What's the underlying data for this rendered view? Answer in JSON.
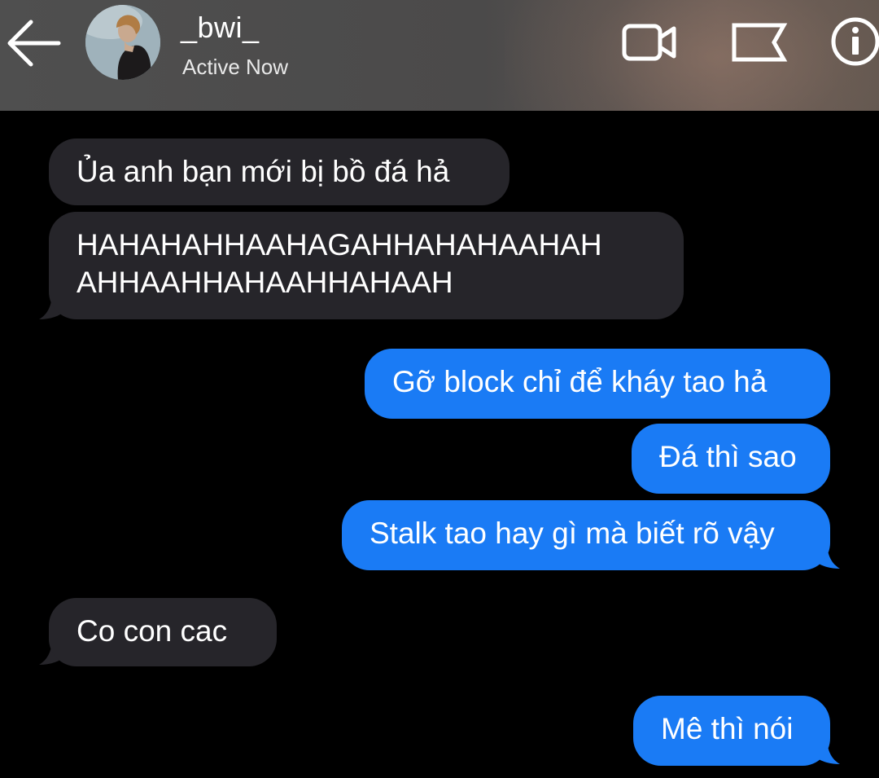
{
  "header": {
    "contact_name": "_bwi_",
    "status": "Active Now",
    "icons": {
      "back": "arrow-left-icon",
      "video": "video-camera-icon",
      "flag": "flag-icon",
      "info": "info-icon"
    }
  },
  "colors": {
    "header_bg": "#4f4f4f",
    "incoming_bubble": "#26252a",
    "outgoing_bubble": "#1a7bf5",
    "background": "#000000"
  },
  "messages": [
    {
      "direction": "incoming",
      "text": "Ủa anh bạn mới bị bồ đá hả"
    },
    {
      "direction": "incoming",
      "line1": "HAHAHAHHAAHAGAHHAHAHAAHAH",
      "line2": "AHHAAHHAHAAHHAHAAH"
    },
    {
      "direction": "outgoing",
      "text": "Gỡ block chỉ để kháy tao hả"
    },
    {
      "direction": "outgoing",
      "text": "Đá thì sao"
    },
    {
      "direction": "outgoing",
      "text": "Stalk tao hay gì mà biết rõ vậy"
    },
    {
      "direction": "incoming",
      "text": "Co con cac"
    },
    {
      "direction": "outgoing",
      "text": "Mê thì nói"
    }
  ]
}
